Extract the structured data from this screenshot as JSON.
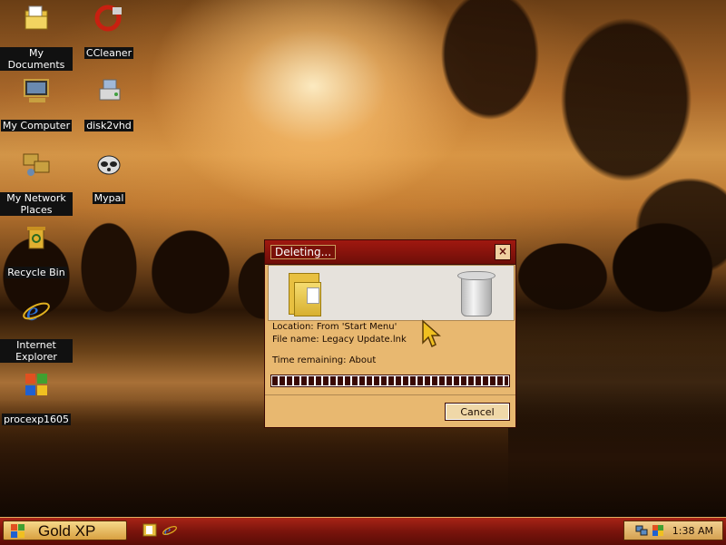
{
  "desktop": {
    "icons": [
      {
        "label": "My Documents",
        "icon": "my-documents-icon"
      },
      {
        "label": "CCleaner",
        "icon": "ccleaner-icon"
      },
      {
        "label": "My Computer",
        "icon": "my-computer-icon"
      },
      {
        "label": "disk2vhd",
        "icon": "disk2vhd-icon"
      },
      {
        "label": "My Network Places",
        "icon": "network-places-icon"
      },
      {
        "label": "Mypal",
        "icon": "mypal-icon"
      },
      {
        "label": "Recycle Bin",
        "icon": "recycle-bin-icon"
      },
      {
        "label": "Internet Explorer",
        "icon": "internet-explorer-icon"
      },
      {
        "label": "procexp1605",
        "icon": "process-explorer-icon"
      }
    ]
  },
  "dialog": {
    "title": "Deleting...",
    "close_glyph": "×",
    "location": "Location: From 'Start Menu'",
    "file_name": "File name: Legacy Update.lnk",
    "time_remaining": "Time remaining:   About",
    "progress": 1.0,
    "cancel_label": "Cancel"
  },
  "taskbar": {
    "start_label": "Gold XP",
    "quick_launch": [
      "folder-icon",
      "internet-explorer-icon"
    ],
    "tray_icons": [
      "network-icon",
      "shield-icon"
    ],
    "clock": "1:38 AM"
  },
  "colors": {
    "taskbar": "#7a140c",
    "dialog_body": "#e8b870",
    "title_bar": "#a01810",
    "accent_gold": "#d8a040"
  }
}
